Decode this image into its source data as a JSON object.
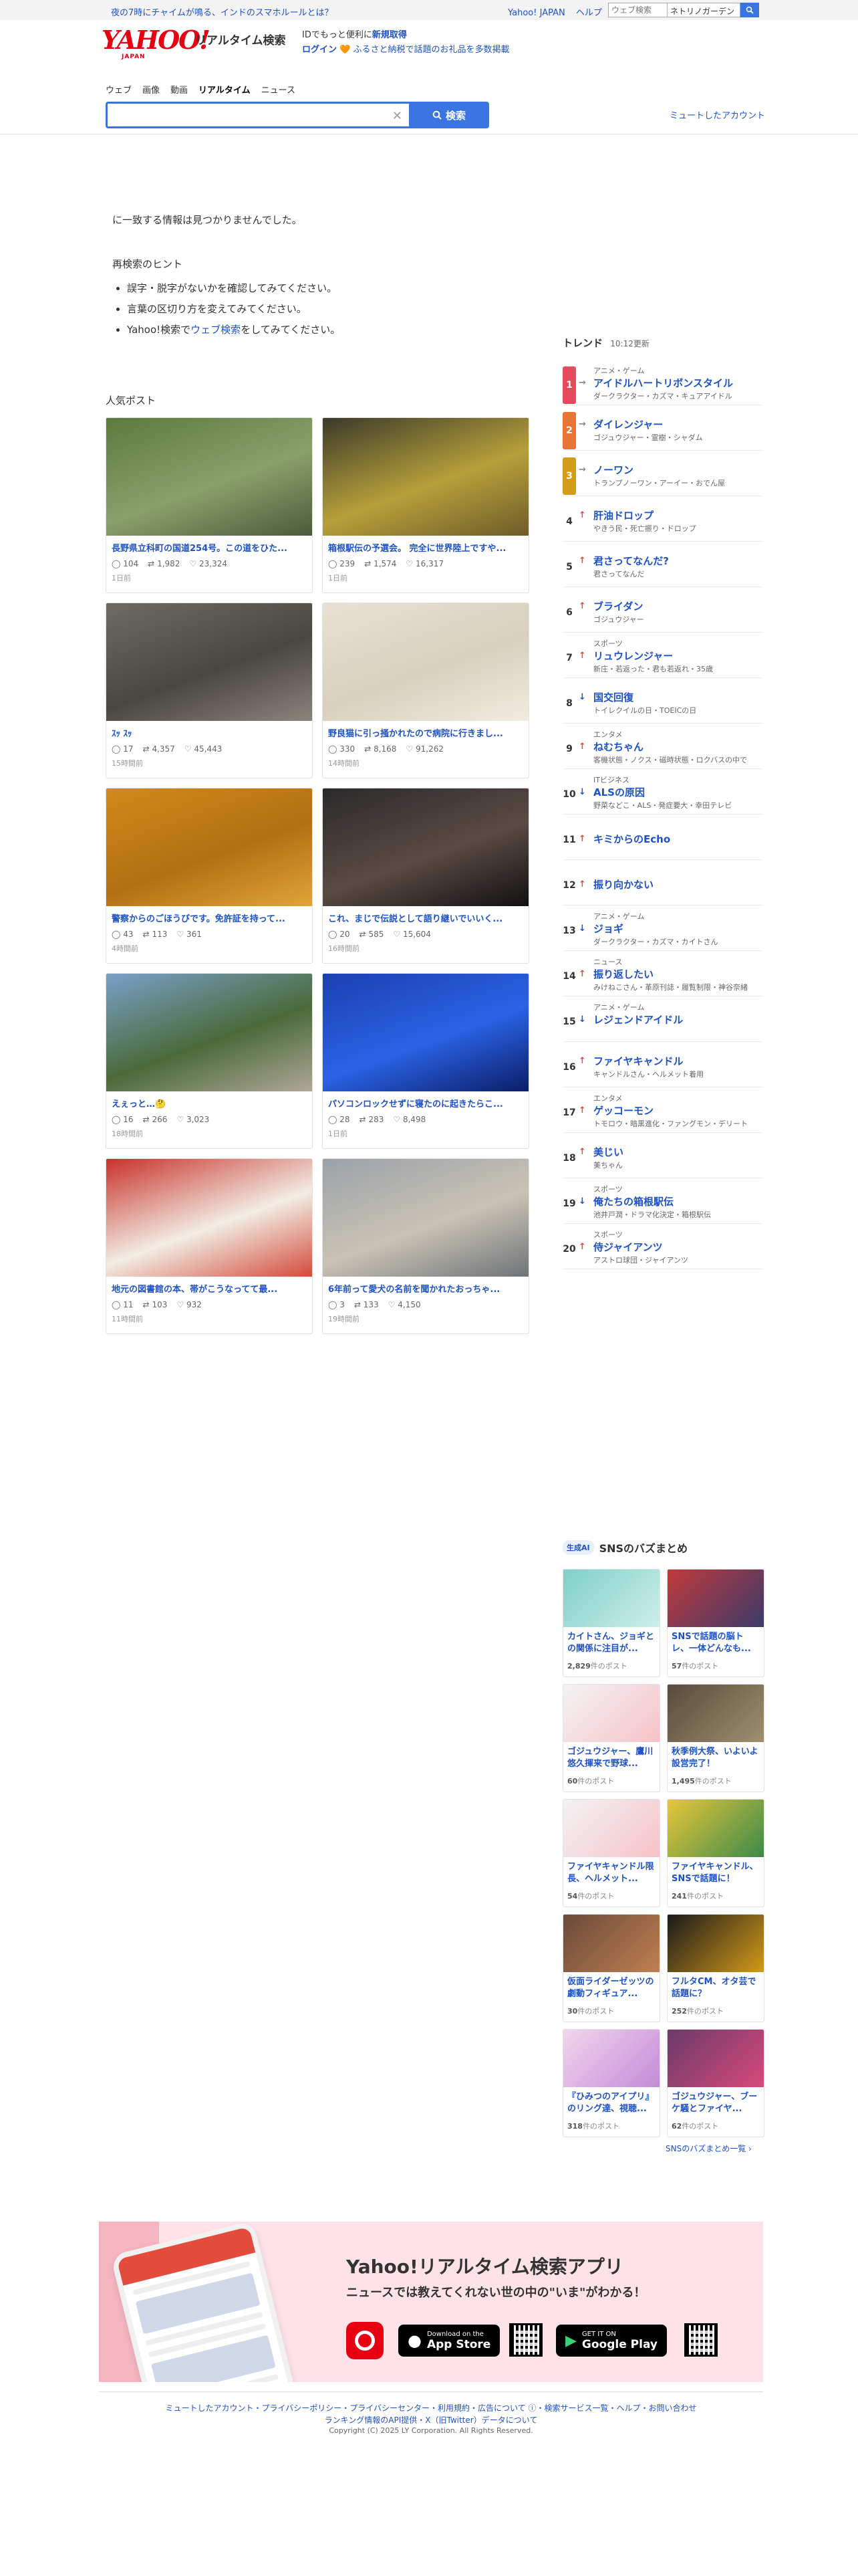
{
  "topbar": {
    "notice": "夜の7時にチャイムが鳴る、インドのスマホルールとは？",
    "links": [
      "Yahoo! JAPAN",
      "ヘルプ"
    ],
    "mini_search_placeholder": "ウェブ検索",
    "mini_search_keyword": "ネトリノガーデン"
  },
  "header": {
    "logo": "YAHOO!",
    "logo_sub": "JAPAN",
    "service_name": "リアルタイム検索",
    "msg_line1_prefix": "IDでもっと便利に",
    "msg_line1_link": "新規取得",
    "msg_login": "ログイン",
    "msg_line2": "ふるさと納税で話題のお礼品を多数掲載"
  },
  "tabs": [
    "ウェブ",
    "画像",
    "動画",
    "リアルタイム",
    "ニュース"
  ],
  "search": {
    "value": "",
    "button_label": "検索",
    "mute_link": "ミュートしたアカウント"
  },
  "no_results": {
    "message": "に一致する情報は見つかりませんでした。",
    "hint_title": "再検索のヒント",
    "hints": [
      "誤字・脱字がないかを確認してみてください。",
      "言葉の区切り方を変えてみてください。"
    ],
    "hint3_prefix": "Yahoo!検索で",
    "hint3_link": "ウェブ検索",
    "hint3_suffix": "をしてみてください。"
  },
  "popular": {
    "title": "人気ポスト",
    "posts": [
      {
        "title": "長野県立科町の国道254号。この道をひた...",
        "replies": "104",
        "reposts": "1,982",
        "likes": "23,324",
        "time": "1日前",
        "colors": [
          "#5c7a3c",
          "#8aa06b",
          "#4b5a3a"
        ]
      },
      {
        "title": "箱根駅伝の予選会。 完全に世界陸上ですや...",
        "replies": "239",
        "reposts": "1,574",
        "likes": "16,317",
        "time": "1日前",
        "colors": [
          "#3b3a2a",
          "#b6a03a",
          "#6d5b2a"
        ]
      },
      {
        "title": "ｽｯ ｽｯ",
        "replies": "17",
        "reposts": "4,357",
        "likes": "45,443",
        "time": "15時間前",
        "colors": [
          "#6e6a64",
          "#4a4640",
          "#8a857d"
        ]
      },
      {
        "title": "野良猫に引っ掻かれたので病院に行きまし...",
        "replies": "330",
        "reposts": "8,168",
        "likes": "91,262",
        "time": "14時間前",
        "colors": [
          "#e8e2d4",
          "#d8d0bc",
          "#f1ece0"
        ]
      },
      {
        "title": "警察からのごほうびです。免許証を持って...",
        "replies": "43",
        "reposts": "113",
        "likes": "361",
        "time": "4時間前",
        "colors": [
          "#d08a1c",
          "#b36f12",
          "#e2a43a"
        ]
      },
      {
        "title": "これ、まじで伝説として語り継いでいいく...",
        "replies": "20",
        "reposts": "585",
        "likes": "15,604",
        "time": "16時間前",
        "colors": [
          "#2a2a2a",
          "#5a4a44",
          "#111111"
        ]
      },
      {
        "title": "えぇっと…🤔",
        "replies": "16",
        "reposts": "266",
        "likes": "3,023",
        "time": "18時間前",
        "colors": [
          "#7aa0c8",
          "#4a6a3a",
          "#b0a898"
        ]
      },
      {
        "title": "パソコンロックせずに寝たのに起きたらこ...",
        "replies": "28",
        "reposts": "283",
        "likes": "8,498",
        "time": "1日前",
        "colors": [
          "#1c3fb0",
          "#2b62e6",
          "#0a1e66"
        ]
      },
      {
        "title": "地元の図書館の本、帯がこうなってて最...",
        "replies": "11",
        "reposts": "103",
        "likes": "932",
        "time": "11時間前",
        "colors": [
          "#c8322a",
          "#f2ede4",
          "#d44a3a"
        ]
      },
      {
        "title": "6年前って愛犬の名前を聞かれたおっちゃ...",
        "replies": "3",
        "reposts": "133",
        "likes": "4,150",
        "time": "19時間前",
        "colors": [
          "#9aa2a8",
          "#c9c2b4",
          "#6e7478"
        ]
      }
    ]
  },
  "trend": {
    "title": "トレンド",
    "updated": "10:12更新",
    "items": [
      {
        "rank": "1",
        "arrow": "→",
        "dir": "flat",
        "cat": "アニメ・ゲーム",
        "name": "アイドルハートリボンスタイル",
        "sub": "ダークラクター・カズマ・キュアアイドル",
        "color": "#e34b5c"
      },
      {
        "rank": "2",
        "arrow": "→",
        "dir": "flat",
        "cat": "",
        "name": "ダイレンジャー",
        "sub": "ゴジュウジャー・霊樹・シャダム",
        "color": "#e87536"
      },
      {
        "rank": "3",
        "arrow": "→",
        "dir": "flat",
        "cat": "",
        "name": "ノーワン",
        "sub": "トランプノーワン・アーイー・おでん屋",
        "color": "#d49a1a"
      },
      {
        "rank": "4",
        "arrow": "↑",
        "dir": "up",
        "cat": "",
        "name": "肝油ドロップ",
        "sub": "やきう民・死亡振り・ドロップ",
        "color": ""
      },
      {
        "rank": "5",
        "arrow": "↑",
        "dir": "up",
        "cat": "",
        "name": "君さってなんだ?",
        "sub": "君さってなんだ",
        "color": ""
      },
      {
        "rank": "6",
        "arrow": "↑",
        "dir": "up",
        "cat": "",
        "name": "ブライダン",
        "sub": "ゴジュウジャー",
        "color": ""
      },
      {
        "rank": "7",
        "arrow": "↑",
        "dir": "up",
        "cat": "スポーツ",
        "name": "リュウレンジャー",
        "sub": "新庄・若返った・君も若返れ・35歳",
        "color": ""
      },
      {
        "rank": "8",
        "arrow": "↓",
        "dir": "down",
        "cat": "",
        "name": "国交回復",
        "sub": "トイレクイルの日・TOEICの日",
        "color": ""
      },
      {
        "rank": "9",
        "arrow": "↑",
        "dir": "up",
        "cat": "エンタメ",
        "name": "ねむちゃん",
        "sub": "客機状態・ノクス・磁時状態・ロクバスの中で",
        "color": ""
      },
      {
        "rank": "10",
        "arrow": "↓",
        "dir": "down",
        "cat": "ITビジネス",
        "name": "ALSの原因",
        "sub": "野菜などこ・ALS・発症要大・幸田テレビ",
        "color": ""
      },
      {
        "rank": "11",
        "arrow": "↑",
        "dir": "up",
        "cat": "",
        "name": "キミからのEcho",
        "sub": "",
        "color": ""
      },
      {
        "rank": "12",
        "arrow": "↑",
        "dir": "up",
        "cat": "",
        "name": "振り向かない",
        "sub": "",
        "color": ""
      },
      {
        "rank": "13",
        "arrow": "↓",
        "dir": "down",
        "cat": "アニメ・ゲーム",
        "name": "ジョギ",
        "sub": "ダークラクター・カズマ・カイトさん",
        "color": ""
      },
      {
        "rank": "14",
        "arrow": "↑",
        "dir": "up",
        "cat": "ニュース",
        "name": "振り返したい",
        "sub": "みけねこさん・革原刊誌・履覧制限・神谷奈緒",
        "color": ""
      },
      {
        "rank": "15",
        "arrow": "↓",
        "dir": "down",
        "cat": "アニメ・ゲーム",
        "name": "レジェンドアイドル",
        "sub": "",
        "color": ""
      },
      {
        "rank": "16",
        "arrow": "↑",
        "dir": "up",
        "cat": "",
        "name": "ファイヤキャンドル",
        "sub": "キャンドルさん・ヘルメット着用",
        "color": ""
      },
      {
        "rank": "17",
        "arrow": "↑",
        "dir": "up",
        "cat": "エンタメ",
        "name": "ゲッコーモン",
        "sub": "トモロウ・暗黒進化・ファングモン・デリート",
        "color": ""
      },
      {
        "rank": "18",
        "arrow": "↑",
        "dir": "up",
        "cat": "",
        "name": "美じい",
        "sub": "美ちゃん",
        "color": ""
      },
      {
        "rank": "19",
        "arrow": "↓",
        "dir": "down",
        "cat": "スポーツ",
        "name": "俺たちの箱根駅伝",
        "sub": "池井戸潤・ドラマ化決定・箱根駅伝",
        "color": ""
      },
      {
        "rank": "20",
        "arrow": "↑",
        "dir": "up",
        "cat": "スポーツ",
        "name": "侍ジャイアンツ",
        "sub": "アストロ球団・ジャイアンツ",
        "color": ""
      }
    ]
  },
  "buzz": {
    "badge": "生成AI",
    "title": "SNSのバズまとめ",
    "items": [
      {
        "title": "カイトさん、ジョギとの関係に注目が...",
        "count": "2,829",
        "unit": "件のポスト",
        "colors": [
          "#7fd0c8",
          "#cfeeea"
        ]
      },
      {
        "title": "SNSで話題の脳トレ、一体どんなも...",
        "count": "57",
        "unit": "件のポスト",
        "colors": [
          "#c03a3a",
          "#3a3a6a"
        ]
      },
      {
        "title": "ゴジュウジャー、鷹川悠久揮来で野球...",
        "count": "60",
        "unit": "件のポスト",
        "colors": [
          "#f3f3f3",
          "#f6c2c8"
        ]
      },
      {
        "title": "秋季例大祭、いよいよ設営完了！",
        "count": "1,495",
        "unit": "件のポスト",
        "colors": [
          "#5a4a3a",
          "#a09070"
        ]
      },
      {
        "title": "ファイヤキャンドル限長、ヘルメット...",
        "count": "54",
        "unit": "件のポスト",
        "colors": [
          "#f3f3f3",
          "#f6c2c8"
        ]
      },
      {
        "title": "ファイヤキャンドル、SNSで話題に！",
        "count": "241",
        "unit": "件のポスト",
        "colors": [
          "#e8c63a",
          "#3a8a4a"
        ]
      },
      {
        "title": "仮面ライダーゼッツの劇動フィギュア...",
        "count": "30",
        "unit": "件のポスト",
        "colors": [
          "#6a4a3a",
          "#c08050"
        ]
      },
      {
        "title": "フルタCM、オタ芸で話題に？",
        "count": "252",
        "unit": "件のポスト",
        "colors": [
          "#1a1a1a",
          "#d49a1a"
        ]
      },
      {
        "title": "『ひみつのアイプリ』のリング達、視聴...",
        "count": "318",
        "unit": "件のポスト",
        "colors": [
          "#f2d6ec",
          "#c28ad8"
        ]
      },
      {
        "title": "ゴジュウジャー、ブーケ騒とファイヤ...",
        "count": "62",
        "unit": "件のポスト",
        "colors": [
          "#6a3a6a",
          "#d84a7a"
        ]
      }
    ],
    "more": "SNSのバズまとめ一覧"
  },
  "banner": {
    "title": "Yahoo!リアルタイム検索アプリ",
    "subtitle": "ニュースでは教えてくれない世の中の\"いま\"がわかる！",
    "appstore_small": "Download on the",
    "appstore": "App Store",
    "gplay_small": "GET IT ON",
    "gplay": "Google Play"
  },
  "footer": {
    "line1": "ミュートしたアカウント・プライバシーポリシー・プライバシーセンター・利用規約・広告について ⓘ・検索サービス一覧・ヘルプ・お問い合わせ",
    "line2": "ランキング情報のAPI提供・X（旧Twitter）データについて",
    "copyright": "Copyright (C) 2025 LY Corporation. All Rights Reserved."
  }
}
